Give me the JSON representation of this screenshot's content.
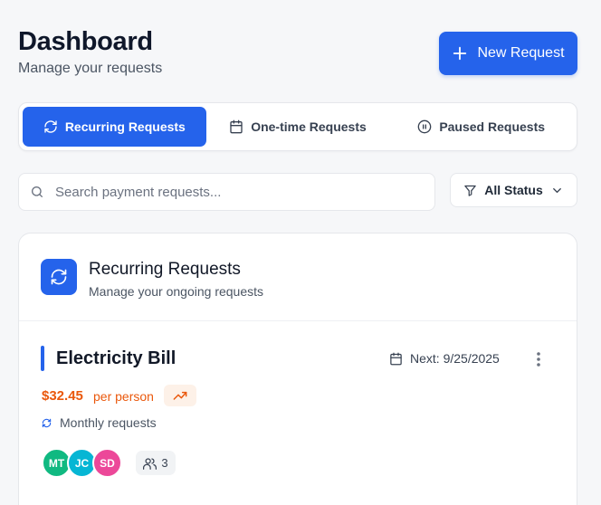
{
  "header": {
    "title": "Dashboard",
    "subtitle": "Manage your requests",
    "new_button_label": "New Request"
  },
  "tabs": [
    {
      "label": "Recurring Requests",
      "icon": "refresh-icon",
      "active": true
    },
    {
      "label": "One-time Requests",
      "icon": "calendar-icon",
      "active": false
    },
    {
      "label": "Paused Requests",
      "icon": "pause-circle-icon",
      "active": false
    }
  ],
  "search": {
    "placeholder": "Search payment requests...",
    "value": ""
  },
  "filter": {
    "label": "All Status",
    "icon": "filter-icon"
  },
  "section": {
    "title": "Recurring Requests",
    "subtitle": "Manage your ongoing requests",
    "icon": "refresh-icon"
  },
  "items": [
    {
      "name": "Electricity Bill",
      "next_label": "Next: 9/25/2025",
      "amount": "$32.45",
      "per_label": "per person",
      "frequency": "Monthly requests",
      "participants": [
        {
          "initials": "MT",
          "color": "#10b981"
        },
        {
          "initials": "JC",
          "color": "#06b6d4"
        },
        {
          "initials": "SD",
          "color": "#ec4899"
        }
      ],
      "participant_count": "3"
    }
  ],
  "colors": {
    "accent": "#2563eb",
    "amount": "#ea580c",
    "background": "#f6f7f9"
  }
}
